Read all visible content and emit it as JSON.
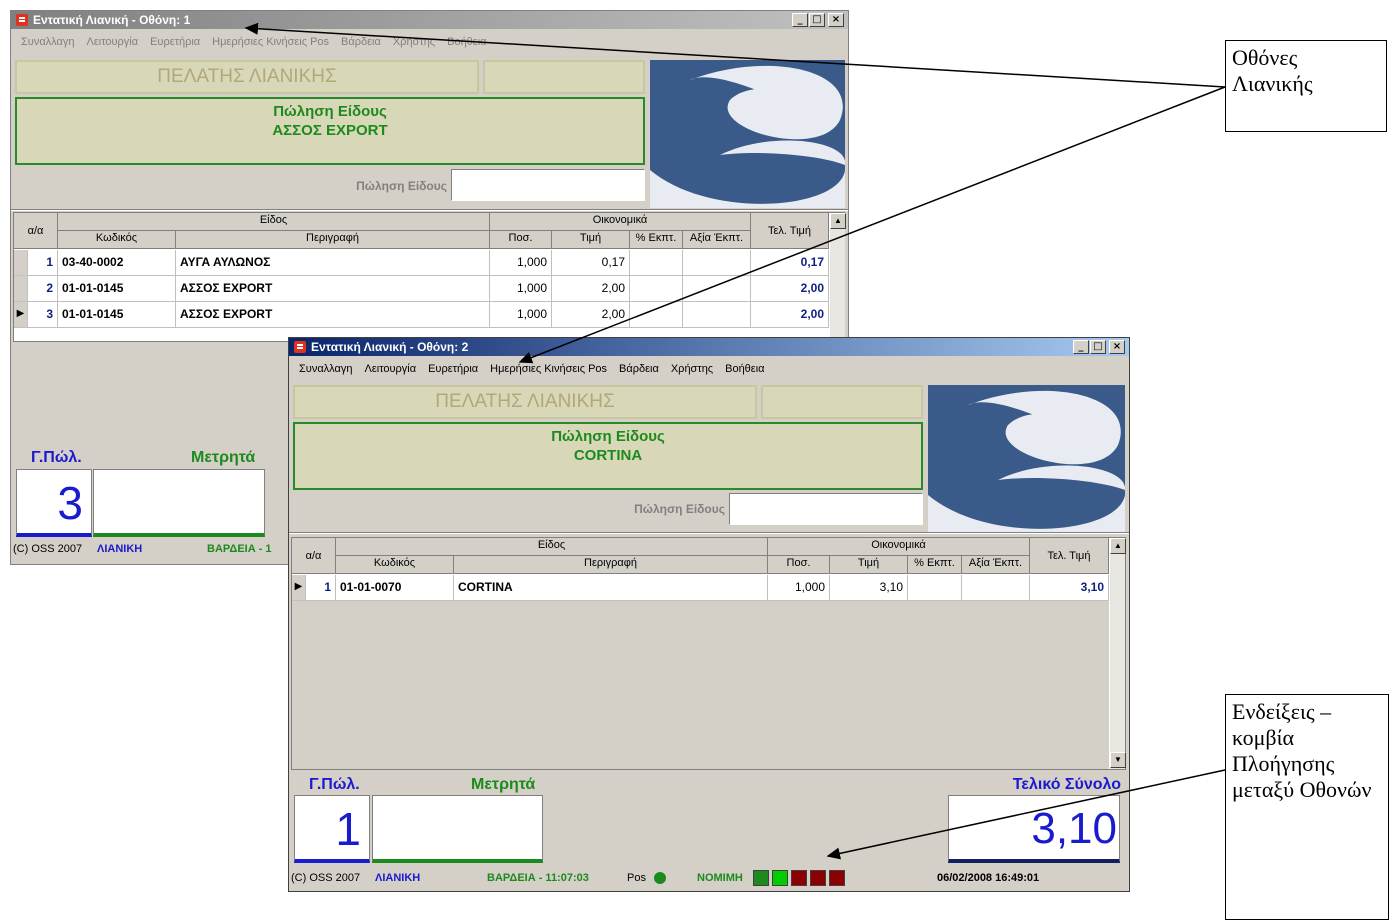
{
  "colors": {
    "title_active": "#0a246a",
    "title_inactive": "#808080",
    "green": "#1c8a1c",
    "blue": "#1a1ad0",
    "dark_red": "#8b0000"
  },
  "window1": {
    "title": "Εντατική Λιανική - Οθόνη: 1",
    "menu": [
      "Συναλλαγη",
      "Λειτουργία",
      "Ευρετήρια",
      "Ημερήσιες Κινήσεις Pos",
      "Βάρδεια",
      "Χρήστης",
      "Βοήθεια"
    ],
    "customer": "ΠΕΛΑΤΗΣ ΛΙΑΝΙΚΗΣ",
    "sale_title": "Πώληση Είδους",
    "sale_item": "ΑΣΣΟΣ EXPORT",
    "sale_field_label": "Πώληση Είδους",
    "headers": {
      "aa": "α/α",
      "eidos": "Είδος",
      "oikonomika": "Οικονομικά",
      "code": "Κωδικός",
      "desc": "Περιγραφή",
      "qty": "Ποσ.",
      "price": "Τιμή",
      "disc": "% Εκπτ.",
      "disc_val": "Αξία Έκπτ.",
      "final": "Τελ. Τιμή"
    },
    "rows": [
      {
        "n": "1",
        "code": "03-40-0002",
        "desc": "ΑΥΓΑ ΑΥΛΩΝΟΣ",
        "qty": "1,000",
        "price": "0,17",
        "final": "0,17"
      },
      {
        "n": "2",
        "code": "01-01-0145",
        "desc": "ΑΣΣΟΣ EXPORT",
        "qty": "1,000",
        "price": "2,00",
        "final": "2,00"
      },
      {
        "n": "3",
        "code": "01-01-0145",
        "desc": "ΑΣΣΟΣ EXPORT",
        "qty": "1,000",
        "price": "2,00",
        "final": "2,00"
      }
    ],
    "gpol_label": "Γ.Πώλ.",
    "gpol_value": "3",
    "cash_label": "Μετρητά",
    "status_copyright": "(C) OSS 2007",
    "status_mode": "ΛΙΑΝΙΚΗ",
    "status_shift": "ΒΑΡΔΕΙΑ - 1"
  },
  "window2": {
    "title": "Εντατική Λιανική - Οθόνη: 2",
    "menu": [
      "Συναλλαγη",
      "Λειτουργία",
      "Ευρετήρια",
      "Ημερήσιες Κινήσεις Pos",
      "Βάρδεια",
      "Χρήστης",
      "Βοήθεια"
    ],
    "customer": "ΠΕΛΑΤΗΣ ΛΙΑΝΙΚΗΣ",
    "sale_title": "Πώληση Είδους",
    "sale_item": "CORTINA",
    "sale_field_label": "Πώληση Είδους",
    "headers": {
      "aa": "α/α",
      "eidos": "Είδος",
      "oikonomika": "Οικονομικά",
      "code": "Κωδικός",
      "desc": "Περιγραφή",
      "qty": "Ποσ.",
      "price": "Τιμή",
      "disc": "% Εκπτ.",
      "disc_val": "Αξία Έκπτ.",
      "final": "Τελ. Τιμή"
    },
    "rows": [
      {
        "n": "1",
        "code": "01-01-0070",
        "desc": "CORTINA",
        "qty": "1,000",
        "price": "3,10",
        "final": "3,10"
      }
    ],
    "gpol_label": "Γ.Πώλ.",
    "gpol_value": "1",
    "cash_label": "Μετρητά",
    "total_label": "Τελικό Σύνολο",
    "total_value": "3,10",
    "status_copyright": "(C) OSS 2007",
    "status_mode": "ΛΙΑΝΙΚΗ",
    "status_shift": "ΒΑΡΔΕΙΑ - 11:07:03",
    "status_pos": "Pos",
    "status_legal": "ΝΟΜΙΜΗ",
    "status_datetime": "06/02/2008 16:49:01"
  },
  "callouts": {
    "screens": "Οθόνες Λιανικής",
    "indicators": "Ενδείξεις – κομβία Πλοήγησης μεταξύ Οθονών"
  }
}
